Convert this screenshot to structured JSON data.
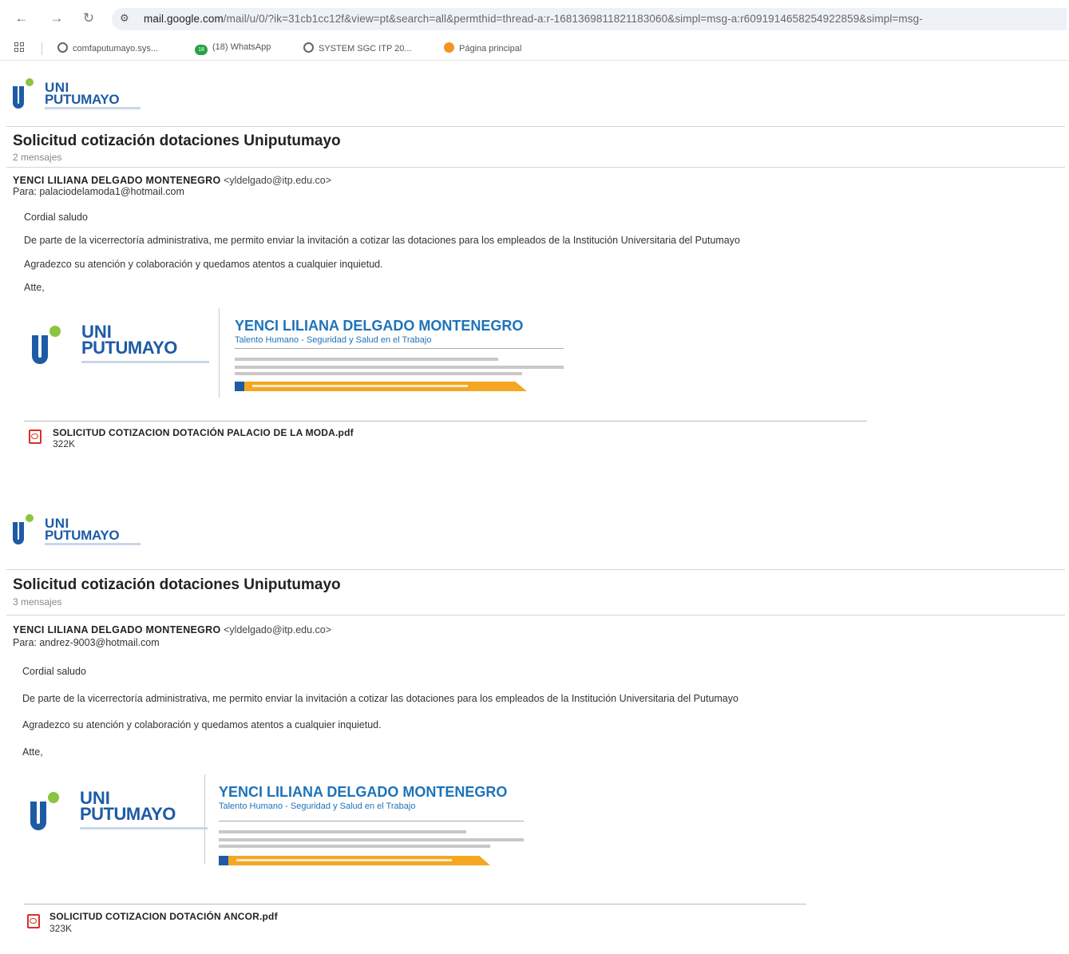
{
  "browser": {
    "url_host": "mail.google.com",
    "url_rest": "/mail/u/0/?ik=31cb1cc12f&view=pt&search=all&permthid=thread-a:r-1681369811821183060&simpl=msg-a:r6091914658254922859&simpl=msg-",
    "bookmarks": [
      {
        "label": "comfaputumayo.sys..."
      },
      {
        "label": "(18) WhatsApp",
        "badge": "18"
      },
      {
        "label": "SYSTEM SGC ITP 20..."
      },
      {
        "label": "Página principal"
      }
    ]
  },
  "messages": [
    {
      "logo_line1": "UNI",
      "logo_line2": "PUTUMAYO",
      "subject": "Solicitud cotización dotaciones Uniputumayo",
      "count": "2 mensajes",
      "sender_name": "YENCI LILIANA DELGADO MONTENEGRO",
      "sender_email": "<yldelgado@itp.edu.co>",
      "to": "Para: palaciodelamoda1@hotmail.com",
      "body": [
        "Cordial saludo",
        "De parte de la vicerrectoría administrativa, me permito enviar la invitación a cotizar las dotaciones para los empleados de la Institución Universitaria del Putumayo",
        "Agradezco su atención y colaboración y quedamos atentos a cualquier inquietud.",
        "Atte,"
      ],
      "signature": {
        "logo_line1": "UNI",
        "logo_line2": "PUTUMAYO",
        "name": "YENCI LILIANA DELGADO MONTENEGRO",
        "role": "Talento Humano - Seguridad y Salud en el Trabajo"
      },
      "attachment_name": "SOLICITUD COTIZACION DOTACIÓN PALACIO DE LA MODA.pdf",
      "attachment_size": "322K"
    },
    {
      "logo_line1": "UNI",
      "logo_line2": "PUTUMAYO",
      "subject": "Solicitud cotización dotaciones Uniputumayo",
      "count": "3 mensajes",
      "sender_name": "YENCI LILIANA DELGADO MONTENEGRO",
      "sender_email": "<yldelgado@itp.edu.co>",
      "to": "Para: andrez-9003@hotmail.com",
      "body": [
        "Cordial saludo",
        "De parte de la vicerrectoría administrativa, me permito enviar la invitación a cotizar las dotaciones para los empleados de la Institución Universitaria del Putumayo",
        "Agradezco su atención y colaboración y quedamos atentos a cualquier inquietud.",
        "Atte,"
      ],
      "signature": {
        "logo_line1": "UNI",
        "logo_line2": "PUTUMAYO",
        "name": "YENCI LILIANA DELGADO MONTENEGRO",
        "role": "Talento Humano - Seguridad y Salud en el Trabajo"
      },
      "attachment_name": "SOLICITUD COTIZACION DOTACIÓN ANCOR.pdf",
      "attachment_size": "323K"
    }
  ],
  "colors": {
    "brand_blue": "#1e5ba6",
    "brand_green": "#8bc53f",
    "brand_orange": "#f5a623",
    "pdf_red": "#d93025"
  }
}
